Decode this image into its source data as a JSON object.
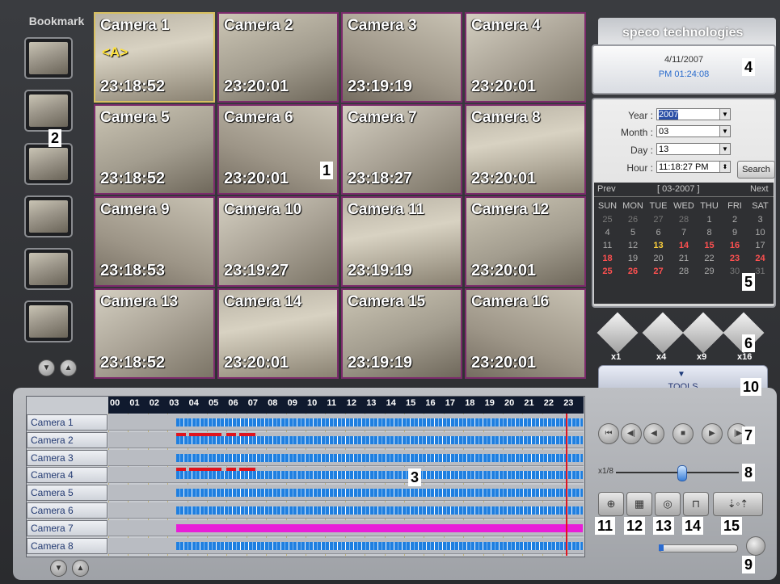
{
  "bookmark": {
    "title": "Bookmark"
  },
  "cameras": [
    {
      "name": "Camera 1",
      "time": "23:18:52",
      "tag": "<A>"
    },
    {
      "name": "Camera 2",
      "time": "23:20:01"
    },
    {
      "name": "Camera 3",
      "time": "23:19:19"
    },
    {
      "name": "Camera 4",
      "time": "23:20:01"
    },
    {
      "name": "Camera 5",
      "time": "23:18:52"
    },
    {
      "name": "Camera 6",
      "time": "23:20:01"
    },
    {
      "name": "Camera 7",
      "time": "23:18:27"
    },
    {
      "name": "Camera 8",
      "time": "23:20:01"
    },
    {
      "name": "Camera 9",
      "time": "23:18:53"
    },
    {
      "name": "Camera 10",
      "time": "23:19:27"
    },
    {
      "name": "Camera 11",
      "time": "23:19:19"
    },
    {
      "name": "Camera 12",
      "time": "23:20:01"
    },
    {
      "name": "Camera 13",
      "time": "23:18:52"
    },
    {
      "name": "Camera 14",
      "time": "23:20:01"
    },
    {
      "name": "Camera 15",
      "time": "23:19:19"
    },
    {
      "name": "Camera 16",
      "time": "23:20:01"
    }
  ],
  "brand": {
    "logo": "speco technologies"
  },
  "datetime": {
    "date": "4/11/2007",
    "time": "PM 01:24:08"
  },
  "search": {
    "year_label": "Year :",
    "year_value": "2007",
    "month_label": "Month :",
    "month_value": "03",
    "day_label": "Day :",
    "day_value": "13",
    "hour_label": "Hour :",
    "hour_value": "11:18:27 PM",
    "button": "Search"
  },
  "calendar": {
    "prev": "Prev",
    "title": "[ 03-2007 ]",
    "next": "Next",
    "weekdays": [
      "SUN",
      "MON",
      "TUE",
      "WED",
      "THU",
      "FRI",
      "SAT"
    ],
    "weeks": [
      [
        "25",
        "26",
        "27",
        "28",
        "1",
        "2",
        "3"
      ],
      [
        "4",
        "5",
        "6",
        "7",
        "8",
        "9",
        "10"
      ],
      [
        "11",
        "12",
        "13",
        "14",
        "15",
        "16",
        "17"
      ],
      [
        "18",
        "19",
        "20",
        "21",
        "22",
        "23",
        "24"
      ],
      [
        "25",
        "26",
        "27",
        "28",
        "29",
        "30",
        "31"
      ]
    ]
  },
  "split_modes": [
    "x1",
    "x4",
    "x9",
    "x16"
  ],
  "tools": {
    "label": "TOOLS"
  },
  "timeline": {
    "hours": [
      "00",
      "01",
      "02",
      "03",
      "04",
      "05",
      "06",
      "07",
      "08",
      "09",
      "10",
      "11",
      "12",
      "13",
      "14",
      "15",
      "16",
      "17",
      "18",
      "19",
      "20",
      "21",
      "22",
      "23"
    ],
    "rows": [
      "Camera 1",
      "Camera 2",
      "Camera 3",
      "Camera 4",
      "Camera 5",
      "Camera 6",
      "Camera 7",
      "Camera 8"
    ]
  },
  "speed": {
    "label": "x1/8"
  },
  "callouts": [
    "1",
    "2",
    "3",
    "4",
    "5",
    "6",
    "7",
    "8",
    "9",
    "10",
    "11",
    "12",
    "13",
    "14",
    "15"
  ]
}
